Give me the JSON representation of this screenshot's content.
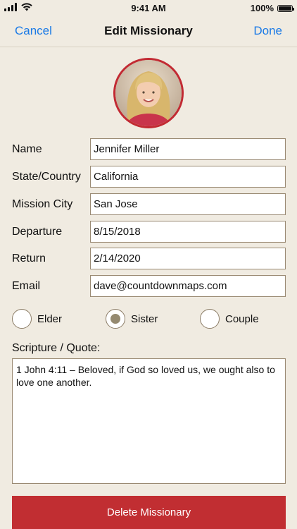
{
  "status_bar": {
    "time": "9:41 AM",
    "battery_percent": "100%",
    "battery_level": 1.0
  },
  "nav": {
    "cancel_label": "Cancel",
    "title": "Edit Missionary",
    "done_label": "Done"
  },
  "form": {
    "fields": [
      {
        "label": "Name",
        "value": "Jennifer Miller"
      },
      {
        "label": "State/Country",
        "value": "California"
      },
      {
        "label": "Mission City",
        "value": "San Jose"
      },
      {
        "label": "Departure",
        "value": "8/15/2018"
      },
      {
        "label": "Return",
        "value": "2/14/2020"
      },
      {
        "label": "Email",
        "value": "dave@countdownmaps.com"
      }
    ],
    "type_options": [
      {
        "label": "Elder",
        "selected": false
      },
      {
        "label": "Sister",
        "selected": true
      },
      {
        "label": "Couple",
        "selected": false
      }
    ],
    "quote_label": "Scripture / Quote:",
    "quote_value": "1 John 4:11 – Beloved, if God so loved us, we ought also to love one another."
  },
  "delete_label": "Delete Missionary",
  "colors": {
    "background": "#f0ebe1",
    "accent_blue": "#1a7ae6",
    "delete_red": "#c12e32",
    "avatar_ring": "#c22a33",
    "radio_fill": "#958a70"
  },
  "icons": {
    "signal": "cellular-signal-icon",
    "wifi": "wifi-icon",
    "battery": "battery-icon"
  }
}
